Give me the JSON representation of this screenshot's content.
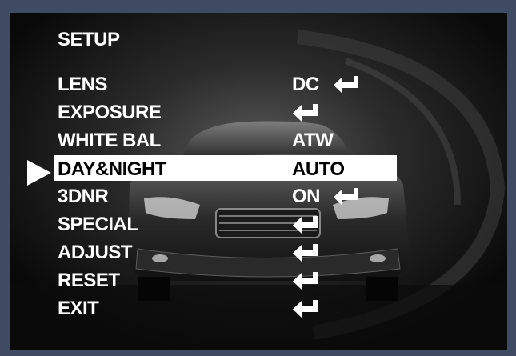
{
  "menu": {
    "title": "SETUP",
    "items": [
      {
        "label": "LENS",
        "value": "DC",
        "enter": true
      },
      {
        "label": "EXPOSURE",
        "value": "",
        "enter": true
      },
      {
        "label": "WHITE BAL",
        "value": "ATW",
        "enter": false
      },
      {
        "label": "DAY&NIGHT",
        "value": "AUTO",
        "enter": false,
        "selected": true
      },
      {
        "label": "3DNR",
        "value": "ON",
        "enter": true
      },
      {
        "label": "SPECIAL",
        "value": "",
        "enter": true
      },
      {
        "label": "ADJUST",
        "value": "",
        "enter": true
      },
      {
        "label": "RESET",
        "value": "",
        "enter": true
      },
      {
        "label": "EXIT",
        "value": "",
        "enter": true
      }
    ]
  },
  "colors": {
    "frame_border": "#3f4a63",
    "highlight": "#ffffff",
    "text": "#ffffff"
  },
  "icons": {
    "cursor": "triangle-right-icon",
    "enter": "enter-arrow-icon"
  }
}
